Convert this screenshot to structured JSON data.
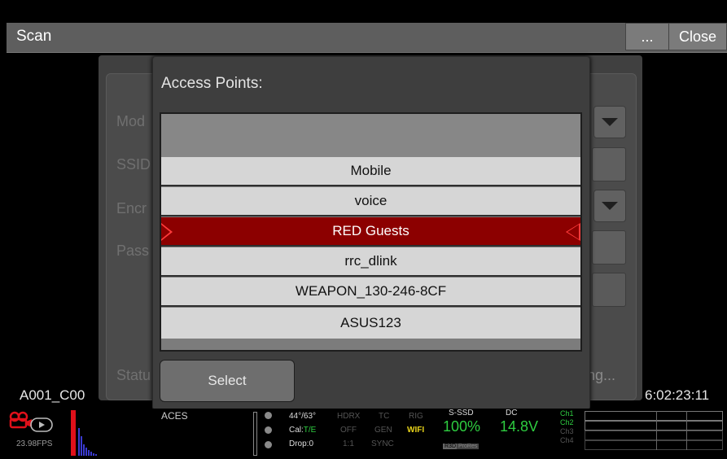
{
  "window": {
    "title": "Scan",
    "more_label": "...",
    "close_label": "Close"
  },
  "background_form": {
    "mode_label": "Mod",
    "ssid_label": "SSID",
    "encryption_label": "Encr",
    "password_label": "Pass",
    "status_label": "Statu",
    "status_value": "ng..."
  },
  "dialog": {
    "title": "Access Points:",
    "access_points": [
      "Mobile",
      "voice",
      "RED Guests",
      "rrc_dlink",
      "WEAPON_130-246-8CF",
      "ASUS123"
    ],
    "selected": "RED Guests",
    "select_label": "Select"
  },
  "overlay": {
    "clip_name": "A001_C00",
    "timecode": "6:02:23:11"
  },
  "status_bar": {
    "fps": "23.98FPS",
    "color_space": "ACES",
    "temp": "44°/63°",
    "cal_label": "Cal:",
    "cal_value": "T/E",
    "drop": "Drop:0",
    "hdrx": "HDRX",
    "hdrx_value": "OFF",
    "ratio": "1:1",
    "tc": "TC",
    "tc_value": "GEN",
    "sync": "SYNC",
    "rig": "RIG",
    "wifi": "WIFI",
    "media_label": "S-SSD",
    "media_value": "100%",
    "codec_r3d": "R3D",
    "codec_prores": "ProRes",
    "power_label": "DC",
    "power_value": "14.8V",
    "channels": [
      "Ch1",
      "Ch2",
      "Ch3",
      "Ch4"
    ],
    "accent_red": "#e0101a",
    "accent_green": "#2ecc40"
  }
}
